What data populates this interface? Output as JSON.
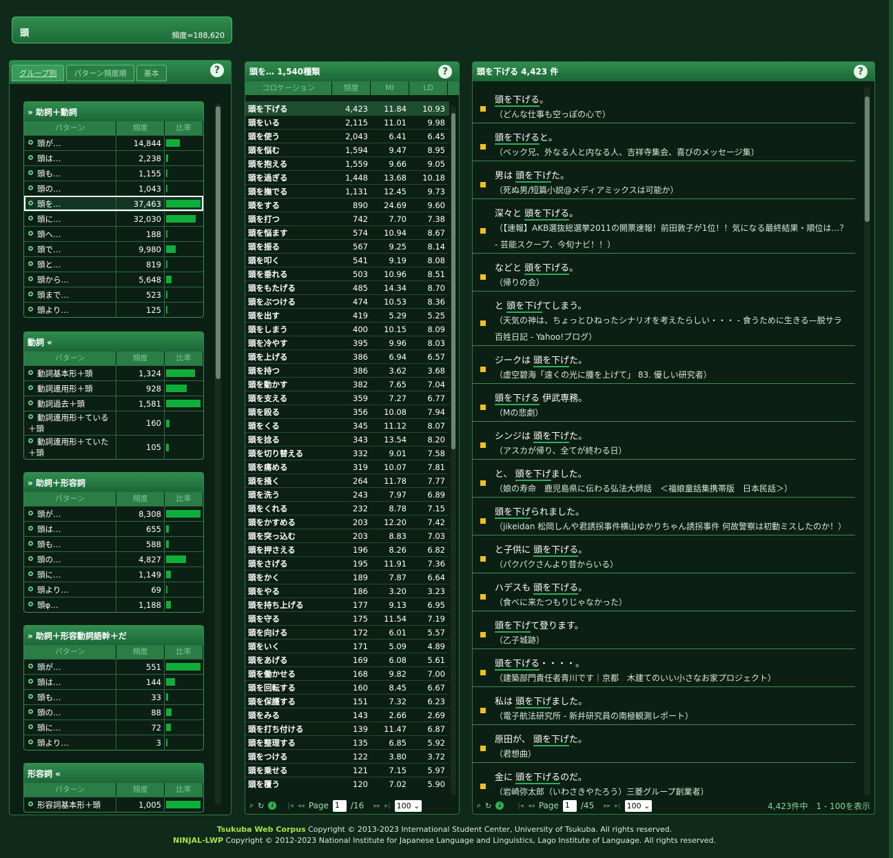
{
  "header": {
    "word": "頭",
    "freq": "頻度=188,620"
  },
  "left": {
    "tabs": [
      "グループ別",
      "パターン頻度順",
      "基本"
    ],
    "help": "?",
    "groups": [
      {
        "title": "» 助詞＋動詞",
        "head": [
          "パターン",
          "頻度",
          "比率"
        ],
        "rows": [
          {
            "p": "頭が…",
            "f": "14,844",
            "r": 0.4
          },
          {
            "p": "頭は…",
            "f": "2,238",
            "r": 0.06
          },
          {
            "p": "頭も…",
            "f": "1,155",
            "r": 0.03
          },
          {
            "p": "頭の…",
            "f": "1,043",
            "r": 0.03
          },
          {
            "p": "頭を…",
            "f": "37,463",
            "r": 1.0,
            "sel": true
          },
          {
            "p": "頭に…",
            "f": "32,030",
            "r": 0.85
          },
          {
            "p": "頭へ…",
            "f": "188",
            "r": 0.01
          },
          {
            "p": "頭で…",
            "f": "9,980",
            "r": 0.27
          },
          {
            "p": "頭と…",
            "f": "819",
            "r": 0.02
          },
          {
            "p": "頭から…",
            "f": "5,648",
            "r": 0.15
          },
          {
            "p": "頭まで…",
            "f": "523",
            "r": 0.02
          },
          {
            "p": "頭より…",
            "f": "125",
            "r": 0.01
          }
        ]
      },
      {
        "title": "動詞 «",
        "head": [
          "パターン",
          "頻度",
          "比率"
        ],
        "rows": [
          {
            "p": "動詞基本形＋頭",
            "f": "1,324",
            "r": 0.84
          },
          {
            "p": "動詞連用形＋頭",
            "f": "928",
            "r": 0.59
          },
          {
            "p": "動詞過去＋頭",
            "f": "1,581",
            "r": 1.0
          },
          {
            "p": "動詞連用形＋ている＋頭",
            "f": "160",
            "r": 0.1,
            "two": true
          },
          {
            "p": "動詞連用形＋ていた＋頭",
            "f": "105",
            "r": 0.07,
            "two": true
          }
        ]
      },
      {
        "title": "» 助詞＋形容詞",
        "head": [
          "パターン",
          "頻度",
          "比率"
        ],
        "rows": [
          {
            "p": "頭が…",
            "f": "8,308",
            "r": 1.0
          },
          {
            "p": "頭は…",
            "f": "655",
            "r": 0.08
          },
          {
            "p": "頭も…",
            "f": "588",
            "r": 0.07
          },
          {
            "p": "頭の…",
            "f": "4,827",
            "r": 0.58
          },
          {
            "p": "頭に…",
            "f": "1,149",
            "r": 0.14
          },
          {
            "p": "頭より…",
            "f": "69",
            "r": 0.01
          },
          {
            "p": "頭φ…",
            "f": "1,188",
            "r": 0.14
          }
        ]
      },
      {
        "title": "» 助詞＋形容動詞語幹＋だ",
        "head": [
          "パターン",
          "頻度",
          "比率"
        ],
        "rows": [
          {
            "p": "頭が…",
            "f": "551",
            "r": 1.0
          },
          {
            "p": "頭は…",
            "f": "144",
            "r": 0.26
          },
          {
            "p": "頭も…",
            "f": "33",
            "r": 0.06
          },
          {
            "p": "頭の…",
            "f": "88",
            "r": 0.16
          },
          {
            "p": "頭に…",
            "f": "72",
            "r": 0.13
          },
          {
            "p": "頭より…",
            "f": "3",
            "r": 0.01
          }
        ]
      },
      {
        "title": "形容詞 «",
        "head": [
          "パターン",
          "頻度",
          "比率"
        ],
        "rows": [
          {
            "p": "形容詞基本形＋頭",
            "f": "1,005",
            "r": 1.0
          }
        ]
      }
    ]
  },
  "middle": {
    "title": "頭を…  1,540種類",
    "head": [
      "コロケーション",
      "頻度",
      "MI",
      "LD"
    ],
    "rows": [
      [
        "頭を下げる",
        "4,423",
        "11.84",
        "10.93"
      ],
      [
        "頭をいる",
        "2,115",
        "11.01",
        "9.98"
      ],
      [
        "頭を使う",
        "2,043",
        "6.41",
        "6.45"
      ],
      [
        "頭を悩む",
        "1,594",
        "9.47",
        "8.95"
      ],
      [
        "頭を抱える",
        "1,559",
        "9.66",
        "9.05"
      ],
      [
        "頭を過ぎる",
        "1,448",
        "13.68",
        "10.18"
      ],
      [
        "頭を撫でる",
        "1,131",
        "12.45",
        "9.73"
      ],
      [
        "頭をする",
        "890",
        "24.69",
        "9.60"
      ],
      [
        "頭を打つ",
        "742",
        "7.70",
        "7.38"
      ],
      [
        "頭を悩ます",
        "574",
        "10.94",
        "8.67"
      ],
      [
        "頭を振る",
        "567",
        "9.25",
        "8.14"
      ],
      [
        "頭を叩く",
        "541",
        "9.19",
        "8.08"
      ],
      [
        "頭を垂れる",
        "503",
        "10.96",
        "8.51"
      ],
      [
        "頭をもたげる",
        "485",
        "14.34",
        "8.70"
      ],
      [
        "頭をぶつける",
        "474",
        "10.53",
        "8.36"
      ],
      [
        "頭を出す",
        "419",
        "5.29",
        "5.25"
      ],
      [
        "頭をしまう",
        "400",
        "10.15",
        "8.09"
      ],
      [
        "頭を冷やす",
        "395",
        "9.96",
        "8.03"
      ],
      [
        "頭を上げる",
        "386",
        "6.94",
        "6.57"
      ],
      [
        "頭を持つ",
        "386",
        "3.62",
        "3.68"
      ],
      [
        "頭を動かす",
        "382",
        "7.65",
        "7.04"
      ],
      [
        "頭を支える",
        "359",
        "7.27",
        "6.77"
      ],
      [
        "頭を殴る",
        "356",
        "10.08",
        "7.94"
      ],
      [
        "頭をくる",
        "345",
        "11.12",
        "8.07"
      ],
      [
        "頭を捻る",
        "343",
        "13.54",
        "8.20"
      ],
      [
        "頭を切り替える",
        "332",
        "9.01",
        "7.58"
      ],
      [
        "頭を痛める",
        "319",
        "10.07",
        "7.81"
      ],
      [
        "頭を掻く",
        "264",
        "11.78",
        "7.77"
      ],
      [
        "頭を洗う",
        "243",
        "7.97",
        "6.89"
      ],
      [
        "頭をくれる",
        "232",
        "8.78",
        "7.15"
      ],
      [
        "頭をかすめる",
        "203",
        "12.20",
        "7.42"
      ],
      [
        "頭を突っ込む",
        "203",
        "8.83",
        "7.03"
      ],
      [
        "頭を押さえる",
        "196",
        "8.26",
        "6.82"
      ],
      [
        "頭をさげる",
        "195",
        "11.91",
        "7.36"
      ],
      [
        "頭をかく",
        "189",
        "7.87",
        "6.64"
      ],
      [
        "頭をやる",
        "186",
        "3.20",
        "3.23"
      ],
      [
        "頭を持ち上げる",
        "177",
        "9.13",
        "6.95"
      ],
      [
        "頭を守る",
        "175",
        "11.54",
        "7.19"
      ],
      [
        "頭を向ける",
        "172",
        "6.01",
        "5.57"
      ],
      [
        "頭をいく",
        "171",
        "5.09",
        "4.89"
      ],
      [
        "頭をあげる",
        "169",
        "6.08",
        "5.61"
      ],
      [
        "頭を働かせる",
        "168",
        "9.82",
        "7.00"
      ],
      [
        "頭を回転する",
        "160",
        "8.45",
        "6.67"
      ],
      [
        "頭を保護する",
        "151",
        "7.32",
        "6.23"
      ],
      [
        "頭をみる",
        "143",
        "2.66",
        "2.69"
      ],
      [
        "頭を打ち付ける",
        "139",
        "11.47",
        "6.87"
      ],
      [
        "頭を整理する",
        "135",
        "6.85",
        "5.92"
      ],
      [
        "頭をつける",
        "122",
        "3.80",
        "3.72"
      ],
      [
        "頭を乗せる",
        "121",
        "7.15",
        "5.97"
      ],
      [
        "頭を覆う",
        "120",
        "7.02",
        "5.90"
      ]
    ],
    "pager": {
      "page_label": "Page",
      "page": "1",
      "of": "/16",
      "per": "100"
    }
  },
  "right": {
    "title": "頭を下げる  4,423 件",
    "examples": [
      {
        "pre": "",
        "hit": "頭を下げる",
        "post": "。",
        "src": "（どんな仕事も空っぽの心で）"
      },
      {
        "pre": "",
        "hit": "頭を下げる",
        "post": "と。",
        "src": "（ベック兄、外なる人と内なる人、吉祥寺集会、喜びのメッセージ集）"
      },
      {
        "pre": "男は ",
        "hit": "頭を下げ",
        "post": "た。",
        "src": "（死ぬ男/短篇小説@メディアミックスは可能か）"
      },
      {
        "pre": "深々と ",
        "hit": "頭を下げる",
        "post": "。",
        "src": "（【速報】AKB選抜総選挙2011の開票速報！前田敦子が1位！！気になる最終結果・順位は…？ - 芸能スクープ、今旬ナビ！！）"
      },
      {
        "pre": "などと ",
        "hit": "頭を下げる",
        "post": "。",
        "src": "（帰りの会）"
      },
      {
        "pre": "と ",
        "hit": "頭を下げ",
        "post": "てしまう。",
        "src": "（天気の神は、ちょっとひねったシナリオを考えたらしい・・・ - 食うために生きる—脱サラ百姓日記 - Yahoo!ブログ）"
      },
      {
        "pre": "ジークは ",
        "hit": "頭を下げ",
        "post": "た。",
        "src": "（虚空碧海「遠くの光に腫を上げて」 83. 優しい研究者）"
      },
      {
        "pre": "",
        "hit": "頭を下げる",
        "post": " 伊武専務。",
        "src": "（Mの悲劇）"
      },
      {
        "pre": "シンジは ",
        "hit": "頭を下げ",
        "post": "た。",
        "src": "（アスカが帰り、全てが終わる日）"
      },
      {
        "pre": "と、 ",
        "hit": "頭を下げ",
        "post": "ました。",
        "src": "（娘の寿命　鹿児島県に伝わる弘法大師話　＜福娘童話集携帯版　日本民話＞）"
      },
      {
        "pre": "",
        "hit": "頭を下げ",
        "post": "られました。",
        "src": "（jikeidan 松岡しんや君誘拐事件横山ゆかりちゃん誘拐事件 何故警察は初動ミスしたのか！）"
      },
      {
        "pre": "と子供に ",
        "hit": "頭を下げる",
        "post": "。",
        "src": "（パクパクさんより昔からいる）"
      },
      {
        "pre": "ハデスも ",
        "hit": "頭を下げる",
        "post": "。",
        "src": "（食べに来たつもりじゃなかった）"
      },
      {
        "pre": "",
        "hit": "頭を下げ",
        "post": "て登ります。",
        "src": "（乙子城跡）"
      },
      {
        "pre": "",
        "hit": "頭を下げる",
        "post": "・・・・。",
        "src": "（建築部門責任者青川です｜京都　木建てのいい小さなお家プロジェクト）"
      },
      {
        "pre": "私は ",
        "hit": "頭を下げ",
        "post": "ました。",
        "src": "（電子航法研究所 - 新井研究員の南極観測レポート）"
      },
      {
        "pre": "原田が、 ",
        "hit": "頭を下げ",
        "post": "た。",
        "src": "（君想曲）"
      },
      {
        "pre": "金に ",
        "hit": "頭を下げる",
        "post": "のだ。",
        "src": "（岩崎弥太郎（いわさきやたろう）三菱グループ創業者）"
      }
    ],
    "pager": {
      "page_label": "Page",
      "page": "1",
      "of": "/45",
      "per": "100",
      "total": "4,423件中　1 - 100を表示"
    }
  },
  "footer": {
    "line1_brand": "Tsukuba Web Corpus",
    "line1_text": " Copyright © 2013-2023 International Student Center, University of Tsukuba. All rights reserved.",
    "line2_brand": "NINJAL-LWP",
    "line2_text": " Copyright © 2012-2023 National Institute for Japanese Language and Linguistics, Lago Institute of Language. All rights reserved."
  }
}
